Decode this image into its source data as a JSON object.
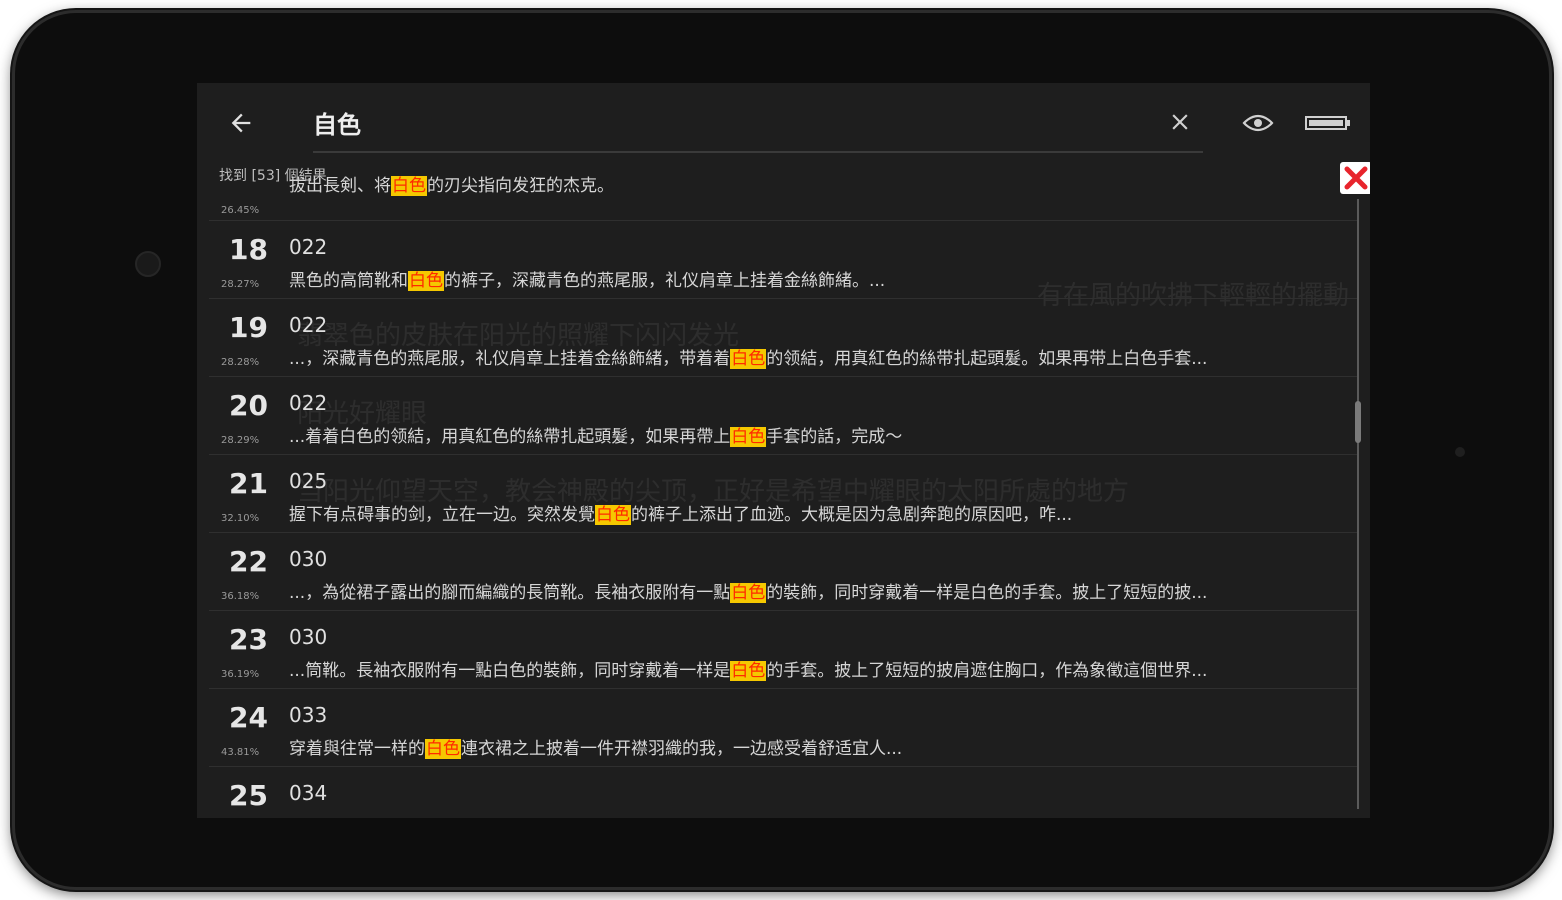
{
  "toolbar": {
    "back_icon": "arrow-left-icon",
    "search_query": "自色",
    "clear_icon": "close-icon",
    "view_icon": "eye-icon",
    "battery_icon": "battery-icon"
  },
  "results_count": "找到 [53] 個結果",
  "overlay_close_icon": "red-x-icon",
  "colors": {
    "background": "#1e1e1e",
    "highlight_bg": "#f5c800",
    "highlight_fg": "#ff2a00",
    "close_red": "#e8242c"
  },
  "results": [
    {
      "num": "",
      "pct": "26.45%",
      "chap": "",
      "pre": "拔出長剣、将",
      "hit": "白色",
      "post": "的刃尖指向发狂的杰克。"
    },
    {
      "num": "18",
      "pct": "28.27%",
      "chap": "022",
      "pre": "黑色的高筒靴和",
      "hit": "白色",
      "post": "的裤子，深藏青色的燕尾服，礼仪肩章上挂着金絲飾緒。..."
    },
    {
      "num": "19",
      "pct": "28.28%",
      "chap": "022",
      "pre": "...，深藏青色的燕尾服，礼仪肩章上挂着金絲飾緒，带着着",
      "hit": "白色",
      "post": "的领結，用真紅色的絲带扎起頭髮。如果再带上白色手套..."
    },
    {
      "num": "20",
      "pct": "28.29%",
      "chap": "022",
      "pre": "...着着白色的领結，用真紅色的絲帶扎起頭髮，如果再帶上",
      "hit": "白色",
      "post": "手套的話，完成～"
    },
    {
      "num": "21",
      "pct": "32.10%",
      "chap": "025",
      "pre": "握下有点碍事的剑，立在一边。突然发覺",
      "hit": "白色",
      "post": "的裤子上添出了血迹。大概是因为急剧奔跑的原因吧，咋..."
    },
    {
      "num": "22",
      "pct": "36.18%",
      "chap": "030",
      "pre": "...，為從裙子露出的腳而編織的長筒靴。長袖衣服附有一點",
      "hit": "白色",
      "post": "的裝飾，同时穿戴着一样是白色的手套。披上了短短的披..."
    },
    {
      "num": "23",
      "pct": "36.19%",
      "chap": "030",
      "pre": "...筒靴。長袖衣服附有一點白色的裝飾，同时穿戴着一样是",
      "hit": "白色",
      "post": "的手套。披上了短短的披肩遮住胸口，作為象徵這個世界..."
    },
    {
      "num": "24",
      "pct": "43.81%",
      "chap": "033",
      "pre": "穿着與往常一样的",
      "hit": "白色",
      "post": "連衣裙之上披着一件开襟羽織的我，一边感受着舒适宜人..."
    },
    {
      "num": "25",
      "pct": "",
      "chap": "034",
      "pre": "",
      "hit": "",
      "post": ""
    }
  ]
}
